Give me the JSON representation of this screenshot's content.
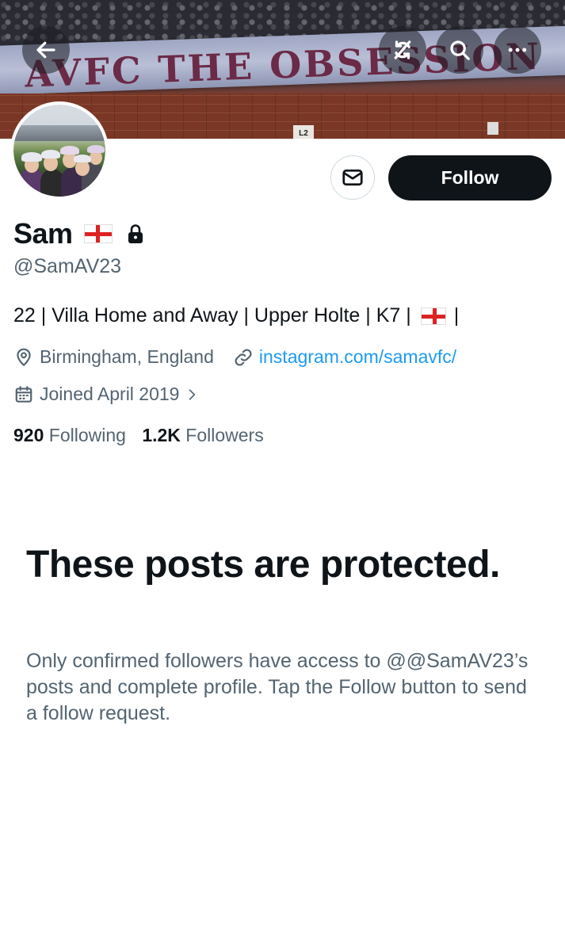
{
  "banner": {
    "text": "AVFC THE OBSESSION",
    "sign": "L2"
  },
  "header_buttons": {
    "back_icon": "arrow-left-icon",
    "refresh_icon": "refresh-slash-icon",
    "search_icon": "search-icon",
    "more_icon": "more-horizontal-icon"
  },
  "profile": {
    "name": "Sam",
    "handle": "@SamAV23",
    "bio_text": "22 | Villa Home and Away | Upper Holte | K7 |",
    "bio_end": "|",
    "location": "Birmingham, England",
    "website": "instagram.com/samavfc/",
    "joined": "Joined April 2019",
    "following_count": "920",
    "following_label": "Following",
    "followers_count": "1.2K",
    "followers_label": "Followers"
  },
  "actions": {
    "follow_label": "Follow",
    "message_icon": "envelope-icon"
  },
  "protected": {
    "title": "These posts are protected.",
    "description": "Only confirmed followers have access to @@SamAV23’s posts and complete profile. Tap the Follow button to send a follow request."
  },
  "colors": {
    "primary_text": "#0f1419",
    "secondary_text": "#536471",
    "link": "#1d9bf0",
    "follow_button": "#0f1419"
  }
}
